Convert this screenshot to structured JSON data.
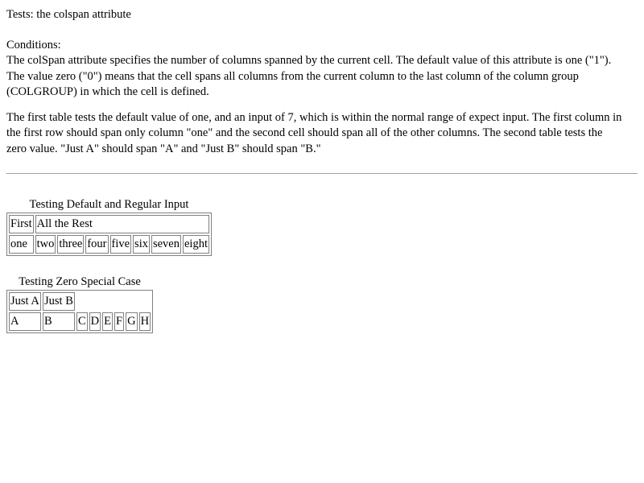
{
  "heading": "Tests: the colspan attribute",
  "conditions": {
    "label": "Conditions:",
    "line1": "The colSpan attribute specifies the number of columns spanned by the current cell. The default value of this attribute is one (\"1\").",
    "line2": "The value zero (\"0\") means that the cell spans all columns from the current column to the last column of the column group",
    "line3": "(COLGROUP) in which the cell is defined."
  },
  "explanation": {
    "line1": "The first table tests the default value of one, and an input of 7, which is within the normal range of expect input. The first column in",
    "line2": "the first row should span only column \"one\" and the second cell should span all of the other columns. The second table tests the",
    "line3": "zero value. \"Just A\" should span \"A\" and \"Just B\" should span \"B.\""
  },
  "table1": {
    "caption": "Testing Default and Regular Input",
    "row1": [
      "First",
      "All the Rest"
    ],
    "row2": [
      "one",
      "two",
      "three",
      "four",
      "five",
      "six",
      "seven",
      "eight"
    ]
  },
  "table2": {
    "caption": "Testing Zero Special Case",
    "row1": [
      "Just A",
      "Just B"
    ],
    "row2": [
      "A",
      "B",
      "C",
      "D",
      "E",
      "F",
      "G",
      "H"
    ]
  }
}
